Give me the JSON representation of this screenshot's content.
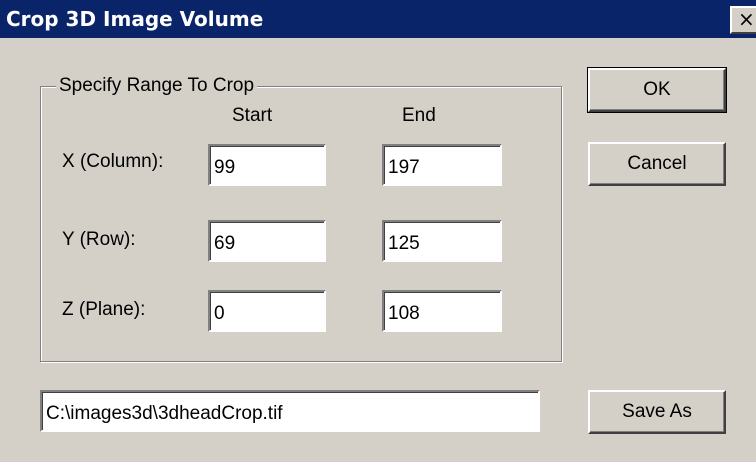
{
  "window": {
    "title": "Crop 3D Image Volume",
    "close_label": "×"
  },
  "range_group": {
    "legend": "Specify Range To Crop",
    "start_header": "Start",
    "end_header": "End",
    "rows": [
      {
        "label": "X (Column):",
        "start": "99",
        "end": "197"
      },
      {
        "label": "Y (Row):",
        "start": "69",
        "end": "125"
      },
      {
        "label": "Z (Plane):",
        "start": "0",
        "end": "108"
      }
    ]
  },
  "buttons": {
    "ok": "OK",
    "cancel": "Cancel",
    "save_as": "Save As"
  },
  "file_path": "C:\\images3d\\3dheadCrop.tif",
  "colors": {
    "titlebar": "#0a246a",
    "dialog_bg": "#d4d0c8"
  }
}
